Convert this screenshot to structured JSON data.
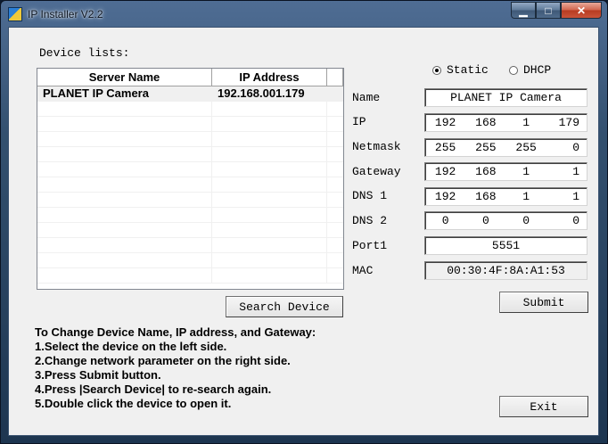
{
  "window": {
    "title": "IP Installer V2.2"
  },
  "window_buttons": {
    "minimize": "▁",
    "maximize": "□",
    "close": "✕"
  },
  "device_list": {
    "label": "Device lists:",
    "columns": [
      "Server Name",
      "IP Address"
    ],
    "rows": [
      {
        "name": "PLANET IP Camera",
        "ip": "192.168.001.179"
      }
    ]
  },
  "mode": {
    "static_label": "Static",
    "dhcp_label": "DHCP",
    "selected": "Static"
  },
  "fields": {
    "name": {
      "label": "Name",
      "value": "PLANET IP Camera"
    },
    "ip": {
      "label": "IP",
      "octets": [
        "192",
        "168",
        "1",
        "179"
      ]
    },
    "netmask": {
      "label": "Netmask",
      "octets": [
        "255",
        "255",
        "255",
        "0"
      ]
    },
    "gateway": {
      "label": "Gateway",
      "octets": [
        "192",
        "168",
        "1",
        "1"
      ]
    },
    "dns1": {
      "label": "DNS 1",
      "octets": [
        "192",
        "168",
        "1",
        "1"
      ]
    },
    "dns2": {
      "label": "DNS 2",
      "octets": [
        "0",
        "0",
        "0",
        "0"
      ]
    },
    "port1": {
      "label": "Port1",
      "value": "5551"
    },
    "mac": {
      "label": "MAC",
      "value": "00:30:4F:8A:A1:53"
    }
  },
  "buttons": {
    "search": "Search Device",
    "submit": "Submit",
    "exit": "Exit"
  },
  "instructions": [
    "To Change Device Name, IP address, and Gateway:",
    "1.Select the device on the left side.",
    "2.Change network parameter on the right side.",
    "3.Press Submit button.",
    "4.Press |Search Device| to re-search again.",
    "5.Double click the device to open it."
  ]
}
